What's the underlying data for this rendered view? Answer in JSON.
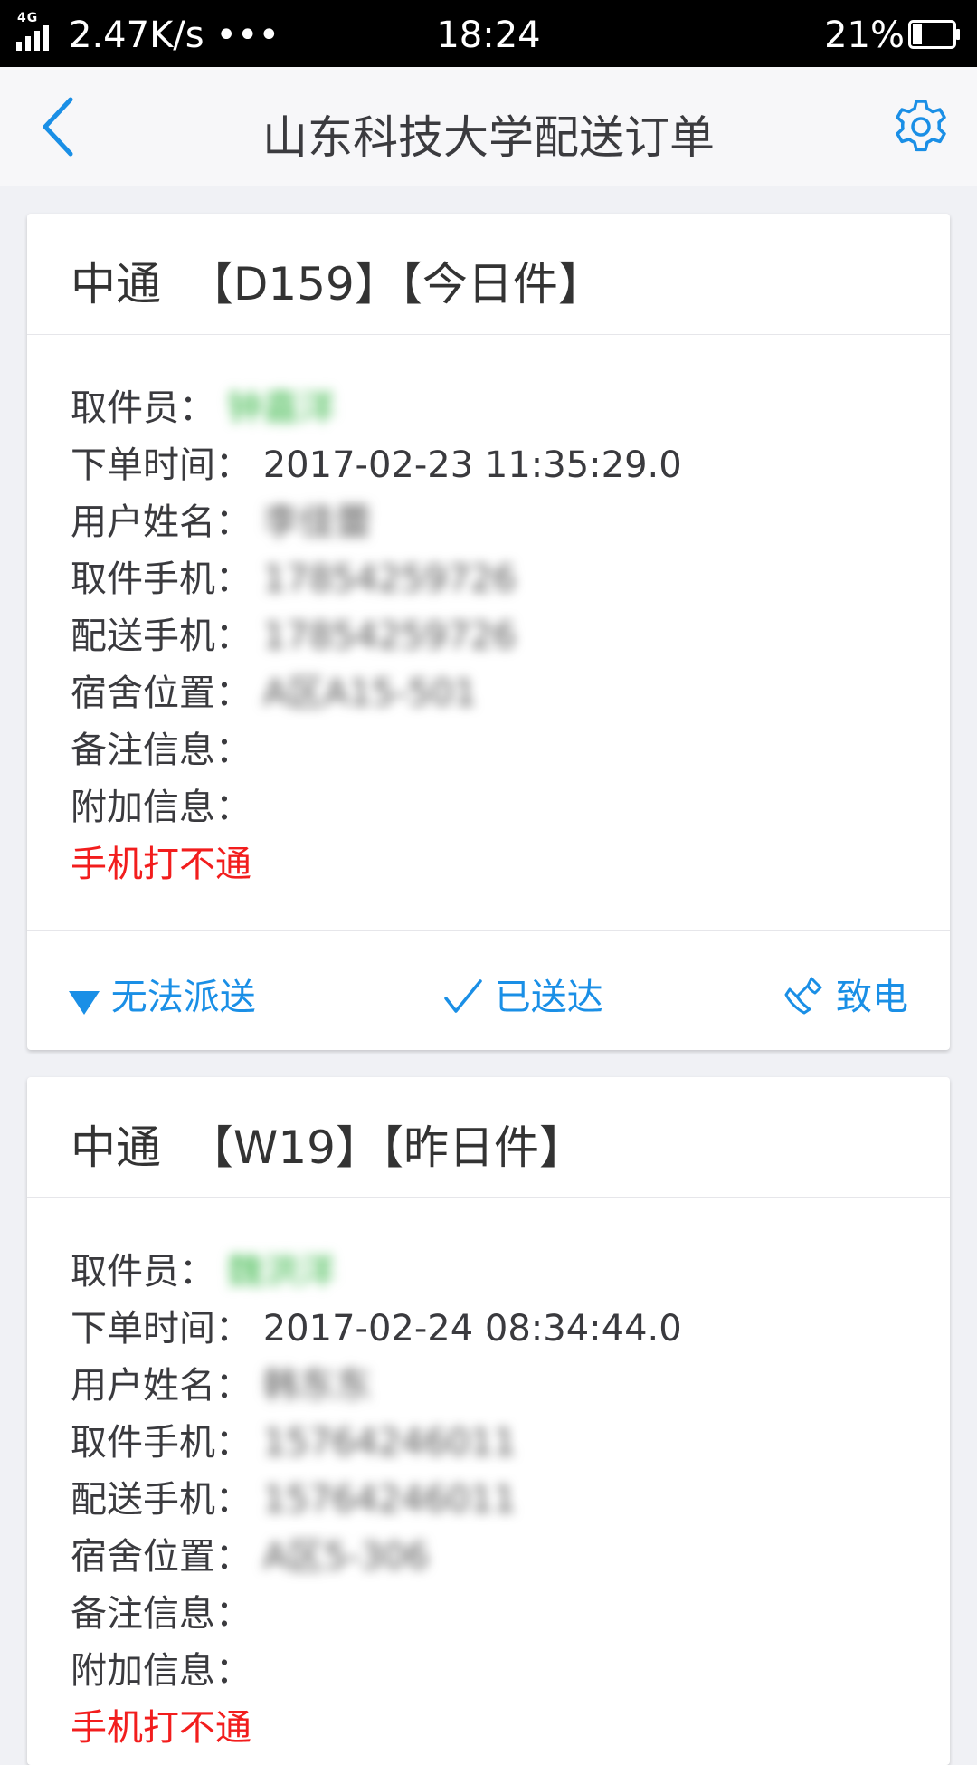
{
  "status_bar": {
    "network": "4G",
    "speed": "2.47K/s •••",
    "time": "18:24",
    "battery": "21%"
  },
  "header": {
    "title": "山东科技大学配送订单",
    "back_icon": "chevron-left-icon",
    "settings_icon": "gear-icon"
  },
  "labels": {
    "picker": "取件员：",
    "order_time": "下单时间：",
    "user_name": "用户姓名：",
    "pickup_phone": "取件手机：",
    "delivery_phone": "配送手机：",
    "dorm": "宿舍位置：",
    "remark": "备注信息：",
    "extra": "附加信息："
  },
  "actions": {
    "undeliverable": "无法派送",
    "delivered": "已送达",
    "call": "致电"
  },
  "orders": [
    {
      "carrier": "中通",
      "code": "【D159】",
      "day": "【今日件】",
      "picker": "钟嘉洋",
      "order_time": "2017-02-23 11:35:29.0",
      "user_name": "李佳蕾",
      "pickup_phone": "17854259726",
      "delivery_phone": "17854259726",
      "dorm": "A区A15-501",
      "remark": "",
      "extra": "",
      "alert": "手机打不通"
    },
    {
      "carrier": "中通",
      "code": "【W19】",
      "day": "【昨日件】",
      "picker": "魏洪洋",
      "order_time": "2017-02-24 08:34:44.0",
      "user_name": "韩东东",
      "pickup_phone": "15764246011",
      "delivery_phone": "15764246011",
      "dorm": "A区5-306",
      "remark": "",
      "extra": "",
      "alert": "手机打不通"
    }
  ],
  "colors": {
    "accent": "#1a8fe6",
    "alert": "#f21d1d",
    "picker": "#3cb84a"
  }
}
